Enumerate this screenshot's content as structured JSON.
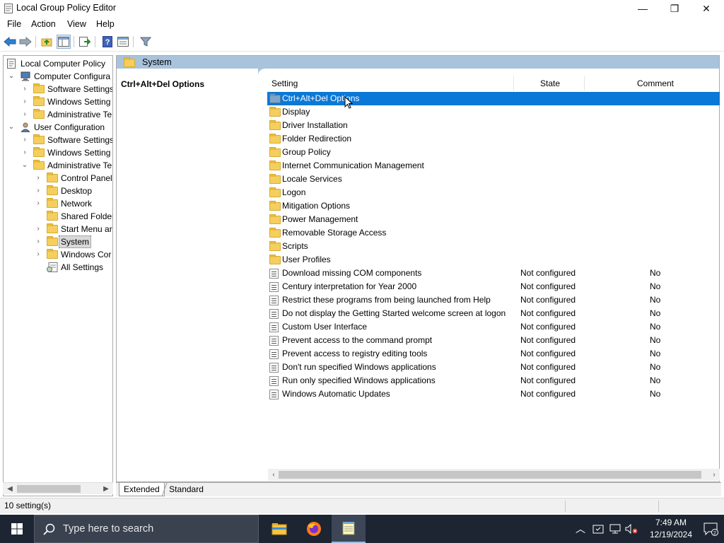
{
  "window": {
    "title": "Local Group Policy Editor",
    "minimize_glyph": "—",
    "maximize_glyph": "❐",
    "close_glyph": "✕"
  },
  "menu": {
    "items": [
      "File",
      "Action",
      "View",
      "Help"
    ]
  },
  "toolbar": {
    "icons": [
      "back-arrow-icon",
      "forward-arrow-icon",
      "up-folder-icon",
      "show-hide-tree-icon",
      "export-list-icon",
      "help-icon",
      "properties-icon",
      "filter-icon"
    ]
  },
  "tree": {
    "items": [
      {
        "label": "Local Computer Policy",
        "expander": "",
        "icon": "policy-icon"
      },
      {
        "label": "Computer Configura",
        "expander": "⌄",
        "icon": "computer-icon"
      },
      {
        "label": "Software Settings",
        "expander": "›",
        "icon": "folder-icon"
      },
      {
        "label": "Windows Setting",
        "expander": "›",
        "icon": "folder-icon"
      },
      {
        "label": "Administrative Te",
        "expander": "›",
        "icon": "folder-icon"
      },
      {
        "label": "User Configuration",
        "expander": "⌄",
        "icon": "user-icon"
      },
      {
        "label": "Software Settings",
        "expander": "›",
        "icon": "folder-icon"
      },
      {
        "label": "Windows Setting",
        "expander": "›",
        "icon": "folder-icon"
      },
      {
        "label": "Administrative Te",
        "expander": "⌄",
        "icon": "folder-icon"
      },
      {
        "label": "Control Panel",
        "expander": "›",
        "icon": "folder-icon"
      },
      {
        "label": "Desktop",
        "expander": "›",
        "icon": "folder-icon"
      },
      {
        "label": "Network",
        "expander": "›",
        "icon": "folder-icon"
      },
      {
        "label": "Shared Folder",
        "expander": "",
        "icon": "folder-icon"
      },
      {
        "label": "Start Menu ar",
        "expander": "›",
        "icon": "folder-icon"
      },
      {
        "label": "System",
        "expander": "›",
        "icon": "folder-icon",
        "selected": true
      },
      {
        "label": "Windows Cor",
        "expander": "›",
        "icon": "folder-icon"
      },
      {
        "label": "All Settings",
        "expander": "",
        "icon": "all-settings-icon"
      }
    ]
  },
  "right_pane": {
    "header_title": "System",
    "selected_title": "Ctrl+Alt+Del Options",
    "columns": {
      "setting": "Setting",
      "state": "State",
      "comment": "Comment"
    },
    "rows": [
      {
        "name": "Ctrl+Alt+Del Options",
        "type": "folder",
        "state": "",
        "comment": "",
        "selected": true
      },
      {
        "name": "Display",
        "type": "folder",
        "state": "",
        "comment": ""
      },
      {
        "name": "Driver Installation",
        "type": "folder",
        "state": "",
        "comment": ""
      },
      {
        "name": "Folder Redirection",
        "type": "folder",
        "state": "",
        "comment": ""
      },
      {
        "name": "Group Policy",
        "type": "folder",
        "state": "",
        "comment": ""
      },
      {
        "name": "Internet Communication Management",
        "type": "folder",
        "state": "",
        "comment": ""
      },
      {
        "name": "Locale Services",
        "type": "folder",
        "state": "",
        "comment": ""
      },
      {
        "name": "Logon",
        "type": "folder",
        "state": "",
        "comment": ""
      },
      {
        "name": "Mitigation Options",
        "type": "folder",
        "state": "",
        "comment": ""
      },
      {
        "name": "Power Management",
        "type": "folder",
        "state": "",
        "comment": ""
      },
      {
        "name": "Removable Storage Access",
        "type": "folder",
        "state": "",
        "comment": ""
      },
      {
        "name": "Scripts",
        "type": "folder",
        "state": "",
        "comment": ""
      },
      {
        "name": "User Profiles",
        "type": "folder",
        "state": "",
        "comment": ""
      },
      {
        "name": "Download missing COM components",
        "type": "setting",
        "state": "Not configured",
        "comment": "No"
      },
      {
        "name": "Century interpretation for Year 2000",
        "type": "setting",
        "state": "Not configured",
        "comment": "No"
      },
      {
        "name": "Restrict these programs from being launched from Help",
        "type": "setting",
        "state": "Not configured",
        "comment": "No"
      },
      {
        "name": "Do not display the Getting Started welcome screen at logon",
        "type": "setting",
        "state": "Not configured",
        "comment": "No"
      },
      {
        "name": "Custom User Interface",
        "type": "setting",
        "state": "Not configured",
        "comment": "No"
      },
      {
        "name": "Prevent access to the command prompt",
        "type": "setting",
        "state": "Not configured",
        "comment": "No"
      },
      {
        "name": "Prevent access to registry editing tools",
        "type": "setting",
        "state": "Not configured",
        "comment": "No"
      },
      {
        "name": "Don't run specified Windows applications",
        "type": "setting",
        "state": "Not configured",
        "comment": "No"
      },
      {
        "name": "Run only specified Windows applications",
        "type": "setting",
        "state": "Not configured",
        "comment": "No"
      },
      {
        "name": "Windows Automatic Updates",
        "type": "setting",
        "state": "Not configured",
        "comment": "No"
      }
    ]
  },
  "tabs": {
    "extended": "Extended",
    "standard": "Standard"
  },
  "status": {
    "text": "10 setting(s)"
  },
  "taskbar": {
    "search_placeholder": "Type here to search",
    "time": "7:49 AM",
    "date": "12/19/2024",
    "notification_count": "2",
    "apps": [
      "file-explorer-icon",
      "firefox-icon",
      "notepad-icon"
    ]
  },
  "colors": {
    "selection": "#0a78d7",
    "header_band": "#a9c3dc",
    "taskbar": "#1c2531"
  }
}
